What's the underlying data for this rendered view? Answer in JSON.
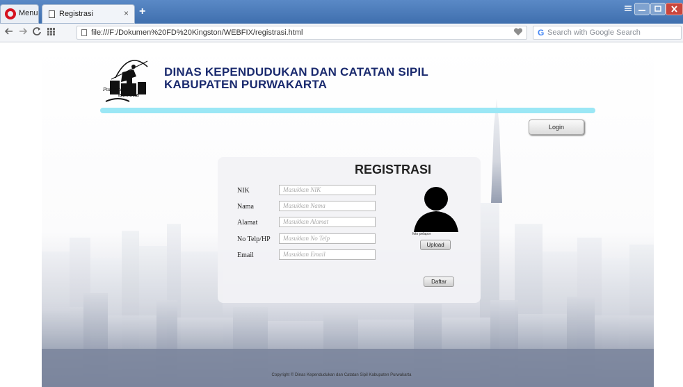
{
  "browser": {
    "menu_label": "Menu",
    "tab_title": "Registrasi",
    "tab_close": "×",
    "new_tab": "+",
    "url": "file:///F:/Dokumen%20FD%20Kingston/WEBFIX/registrasi.html",
    "search_placeholder": "Search with Google Search",
    "search_engine_icon": "G"
  },
  "header": {
    "logo_text_1": "Purwakarta",
    "logo_text_2": "Istimewa",
    "title_line1": "DINAS KEPENDUDUKAN DAN CATATAN SIPIL",
    "title_line2": "KABUPATEN PURWAKARTA",
    "accent_color": "#9be7f5"
  },
  "login_label": "Login",
  "form": {
    "title": "REGISTRASI",
    "fields": [
      {
        "label": "NIK",
        "placeholder": "Masukkan NIK"
      },
      {
        "label": "Nama",
        "placeholder": "Masukkan Nama"
      },
      {
        "label": "Alamat",
        "placeholder": "Masukkan Alamat"
      },
      {
        "label": "No Telp/HP",
        "placeholder": "Masukkan No Telp"
      },
      {
        "label": "Email",
        "placeholder": "Masukkan Email"
      }
    ],
    "photo_caption": "foto pelapor",
    "upload_label": "Upload",
    "submit_label": "Daftar"
  },
  "footer": "Copyright © Dinas Kependudukan dan Catatan Sipil Kabupaten Purwakarta"
}
